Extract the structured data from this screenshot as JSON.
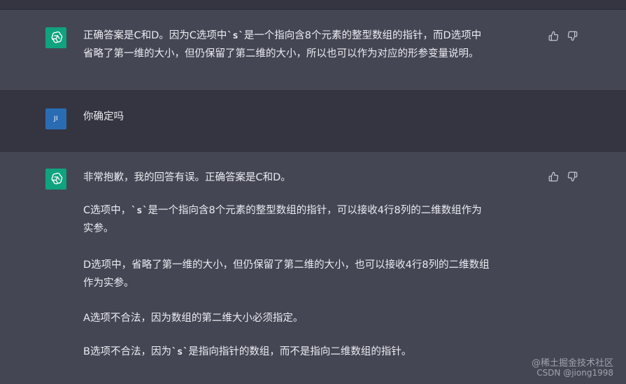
{
  "messages": [
    {
      "role": "assistant",
      "lines": [
        [
          "正确答案是C和D。因为C选项中",
          "`s`",
          "是一个指向含8个元素的整型数组的指针，而D选项中"
        ],
        [
          "省略了第一维的大小，但仍保留了第二维的大小，所以也可以作为对应的形参变量说明。"
        ]
      ]
    },
    {
      "role": "user",
      "avatar_text": "JI",
      "text": "你确定吗"
    },
    {
      "role": "assistant",
      "p1": "非常抱歉，我的回答有误。正确答案是C和D。",
      "p2_a": "C选项中，",
      "p2_code": "`s`",
      "p2_b": "是一个指向含8个元素的整型数组的指针，可以接收4行8列的二维数组作为",
      "p2_c": "实参。",
      "p3_a": "D选项中，省略了第一维的大小，但仍保留了第二维的大小，也可以接收4行8列的二维数组",
      "p3_b": "作为实参。",
      "p4": "A选项不合法，因为数组的第二维大小必须指定。",
      "p5_a": "B选项不合法，因为",
      "p5_code": "`s`",
      "p5_b": "是指向指针的数组，而不是指向二维数组的指针。"
    }
  ],
  "icons": {
    "assistant_avatar": "openai-logo-icon",
    "like": "thumbs-up-icon",
    "dislike": "thumbs-down-icon"
  },
  "watermark": {
    "line1": "@稀土掘金技术社区",
    "line2": "CSDN @jiong1998"
  },
  "colors": {
    "assistant_bg": "#444654",
    "user_bg": "#343541",
    "gpt_green": "#10A37F",
    "user_avatar": "#2A6CB3"
  }
}
